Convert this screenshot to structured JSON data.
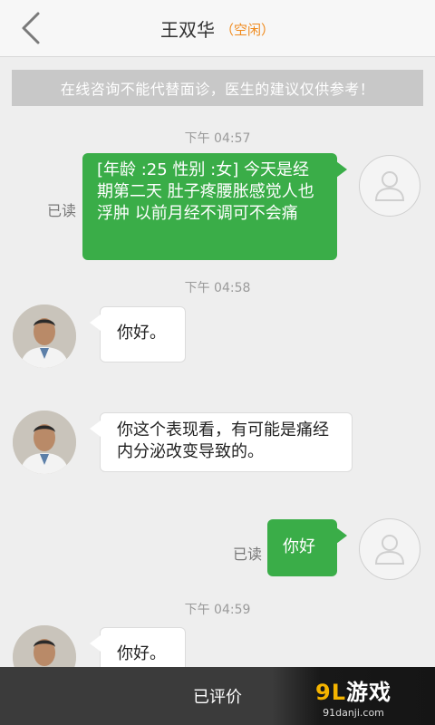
{
  "header": {
    "title": "王双华",
    "status": "（空闲）"
  },
  "notice": "在线咨询不能代替面诊，医生的建议仅供参考！",
  "messages": [
    {
      "time": "下午 04:57",
      "side": "right",
      "text": "[年龄 :25 性别 :女]  今天是经期第二天  肚子疼腰胀感觉人也浮肿  以前月经不调可不会痛",
      "read": "已读"
    },
    {
      "time": "下午 04:58",
      "side": "left",
      "text": "你好。"
    },
    {
      "side": "left",
      "text": "你这个表现看，有可能是痛经内分泌改变导致的。"
    },
    {
      "side": "right",
      "text": "你好",
      "read": "已读"
    },
    {
      "time": "下午 04:59",
      "side": "left",
      "text": "你好。"
    }
  ],
  "bottom": {
    "rated_label": "已评价"
  },
  "watermark": {
    "logo_prefix": "9L",
    "logo_text": "游戏",
    "url": "91danji.com"
  },
  "colors": {
    "bubble_green": "#3aad48",
    "status_orange": "#f08a1c",
    "bottom_bar": "#3b3b3b"
  }
}
